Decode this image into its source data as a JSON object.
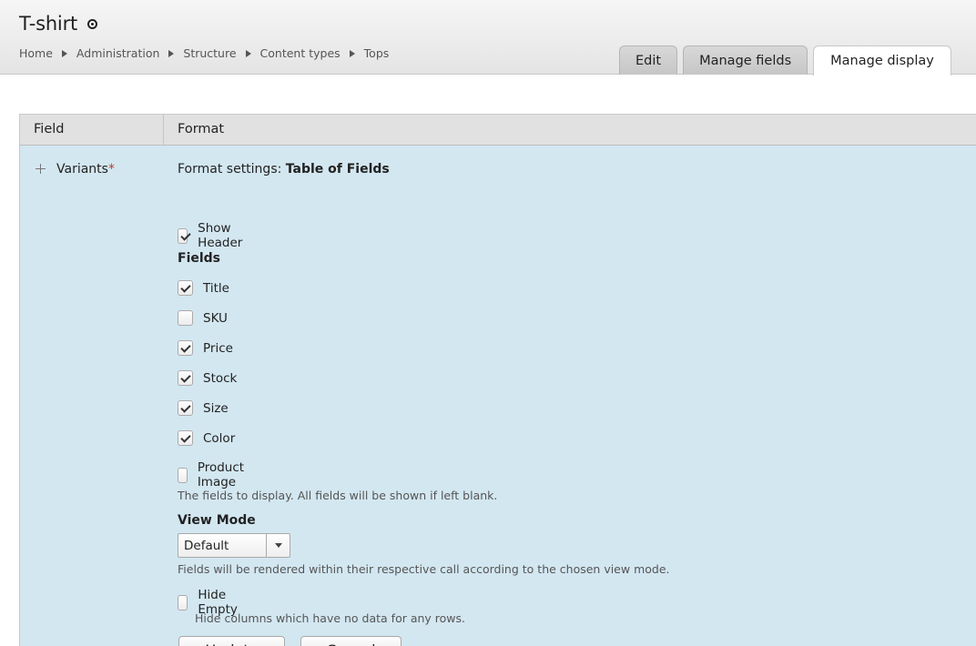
{
  "header": {
    "title": "T-shirt",
    "breadcrumb": [
      "Home",
      "Administration",
      "Structure",
      "Content types",
      "Tops"
    ],
    "tabs": [
      {
        "label": "Edit",
        "active": false
      },
      {
        "label": "Manage fields",
        "active": false
      },
      {
        "label": "Manage display",
        "active": true
      }
    ]
  },
  "table": {
    "columns": [
      "Field",
      "Format"
    ],
    "row": {
      "field_name": "Variants",
      "required_marker": "*",
      "settings": {
        "title_prefix": "Format settings: ",
        "title_value": "Table of Fields",
        "show_header": {
          "label": "Show Header",
          "checked": true
        },
        "fields_label": "Fields",
        "fields": [
          {
            "label": "Title",
            "checked": true
          },
          {
            "label": "SKU",
            "checked": false
          },
          {
            "label": "Price",
            "checked": true
          },
          {
            "label": "Stock",
            "checked": true
          },
          {
            "label": "Size",
            "checked": true
          },
          {
            "label": "Color",
            "checked": true
          },
          {
            "label": "Product Image",
            "checked": false
          }
        ],
        "fields_description": "The fields to display. All fields will be shown if left blank.",
        "view_mode_label": "View Mode",
        "view_mode_value": "Default",
        "view_mode_description": "Fields will be rendered within their respective call according to the chosen view mode.",
        "hide_empty": {
          "label": "Hide Empty",
          "checked": false
        },
        "hide_empty_description": "Hide columns which have no data for any rows.",
        "update_label": "Update",
        "cancel_label": "Cancel"
      }
    }
  }
}
